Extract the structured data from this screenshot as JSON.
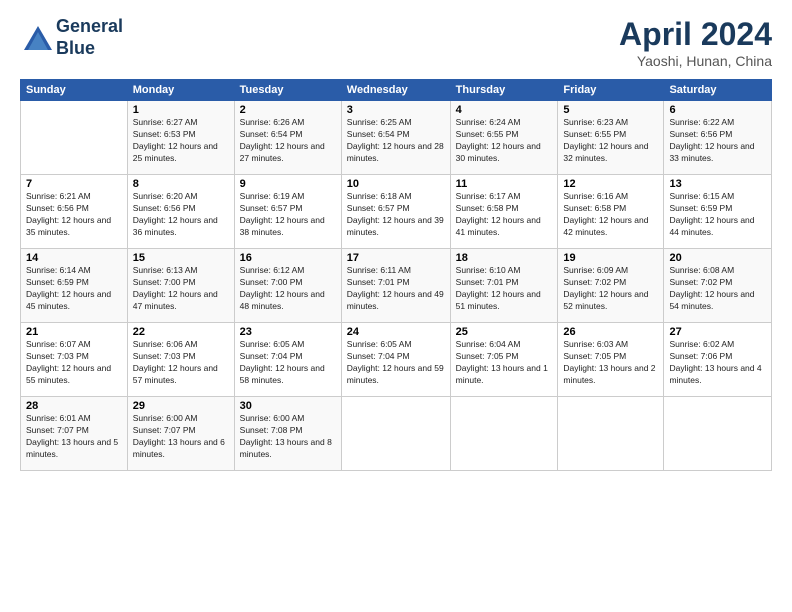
{
  "header": {
    "logo_line1": "General",
    "logo_line2": "Blue",
    "month": "April 2024",
    "location": "Yaoshi, Hunan, China"
  },
  "days_of_week": [
    "Sunday",
    "Monday",
    "Tuesday",
    "Wednesday",
    "Thursday",
    "Friday",
    "Saturday"
  ],
  "weeks": [
    [
      {
        "day": "",
        "sunrise": "",
        "sunset": "",
        "daylight": ""
      },
      {
        "day": "1",
        "sunrise": "Sunrise: 6:27 AM",
        "sunset": "Sunset: 6:53 PM",
        "daylight": "Daylight: 12 hours and 25 minutes."
      },
      {
        "day": "2",
        "sunrise": "Sunrise: 6:26 AM",
        "sunset": "Sunset: 6:54 PM",
        "daylight": "Daylight: 12 hours and 27 minutes."
      },
      {
        "day": "3",
        "sunrise": "Sunrise: 6:25 AM",
        "sunset": "Sunset: 6:54 PM",
        "daylight": "Daylight: 12 hours and 28 minutes."
      },
      {
        "day": "4",
        "sunrise": "Sunrise: 6:24 AM",
        "sunset": "Sunset: 6:55 PM",
        "daylight": "Daylight: 12 hours and 30 minutes."
      },
      {
        "day": "5",
        "sunrise": "Sunrise: 6:23 AM",
        "sunset": "Sunset: 6:55 PM",
        "daylight": "Daylight: 12 hours and 32 minutes."
      },
      {
        "day": "6",
        "sunrise": "Sunrise: 6:22 AM",
        "sunset": "Sunset: 6:56 PM",
        "daylight": "Daylight: 12 hours and 33 minutes."
      }
    ],
    [
      {
        "day": "7",
        "sunrise": "Sunrise: 6:21 AM",
        "sunset": "Sunset: 6:56 PM",
        "daylight": "Daylight: 12 hours and 35 minutes."
      },
      {
        "day": "8",
        "sunrise": "Sunrise: 6:20 AM",
        "sunset": "Sunset: 6:56 PM",
        "daylight": "Daylight: 12 hours and 36 minutes."
      },
      {
        "day": "9",
        "sunrise": "Sunrise: 6:19 AM",
        "sunset": "Sunset: 6:57 PM",
        "daylight": "Daylight: 12 hours and 38 minutes."
      },
      {
        "day": "10",
        "sunrise": "Sunrise: 6:18 AM",
        "sunset": "Sunset: 6:57 PM",
        "daylight": "Daylight: 12 hours and 39 minutes."
      },
      {
        "day": "11",
        "sunrise": "Sunrise: 6:17 AM",
        "sunset": "Sunset: 6:58 PM",
        "daylight": "Daylight: 12 hours and 41 minutes."
      },
      {
        "day": "12",
        "sunrise": "Sunrise: 6:16 AM",
        "sunset": "Sunset: 6:58 PM",
        "daylight": "Daylight: 12 hours and 42 minutes."
      },
      {
        "day": "13",
        "sunrise": "Sunrise: 6:15 AM",
        "sunset": "Sunset: 6:59 PM",
        "daylight": "Daylight: 12 hours and 44 minutes."
      }
    ],
    [
      {
        "day": "14",
        "sunrise": "Sunrise: 6:14 AM",
        "sunset": "Sunset: 6:59 PM",
        "daylight": "Daylight: 12 hours and 45 minutes."
      },
      {
        "day": "15",
        "sunrise": "Sunrise: 6:13 AM",
        "sunset": "Sunset: 7:00 PM",
        "daylight": "Daylight: 12 hours and 47 minutes."
      },
      {
        "day": "16",
        "sunrise": "Sunrise: 6:12 AM",
        "sunset": "Sunset: 7:00 PM",
        "daylight": "Daylight: 12 hours and 48 minutes."
      },
      {
        "day": "17",
        "sunrise": "Sunrise: 6:11 AM",
        "sunset": "Sunset: 7:01 PM",
        "daylight": "Daylight: 12 hours and 49 minutes."
      },
      {
        "day": "18",
        "sunrise": "Sunrise: 6:10 AM",
        "sunset": "Sunset: 7:01 PM",
        "daylight": "Daylight: 12 hours and 51 minutes."
      },
      {
        "day": "19",
        "sunrise": "Sunrise: 6:09 AM",
        "sunset": "Sunset: 7:02 PM",
        "daylight": "Daylight: 12 hours and 52 minutes."
      },
      {
        "day": "20",
        "sunrise": "Sunrise: 6:08 AM",
        "sunset": "Sunset: 7:02 PM",
        "daylight": "Daylight: 12 hours and 54 minutes."
      }
    ],
    [
      {
        "day": "21",
        "sunrise": "Sunrise: 6:07 AM",
        "sunset": "Sunset: 7:03 PM",
        "daylight": "Daylight: 12 hours and 55 minutes."
      },
      {
        "day": "22",
        "sunrise": "Sunrise: 6:06 AM",
        "sunset": "Sunset: 7:03 PM",
        "daylight": "Daylight: 12 hours and 57 minutes."
      },
      {
        "day": "23",
        "sunrise": "Sunrise: 6:05 AM",
        "sunset": "Sunset: 7:04 PM",
        "daylight": "Daylight: 12 hours and 58 minutes."
      },
      {
        "day": "24",
        "sunrise": "Sunrise: 6:05 AM",
        "sunset": "Sunset: 7:04 PM",
        "daylight": "Daylight: 12 hours and 59 minutes."
      },
      {
        "day": "25",
        "sunrise": "Sunrise: 6:04 AM",
        "sunset": "Sunset: 7:05 PM",
        "daylight": "Daylight: 13 hours and 1 minute."
      },
      {
        "day": "26",
        "sunrise": "Sunrise: 6:03 AM",
        "sunset": "Sunset: 7:05 PM",
        "daylight": "Daylight: 13 hours and 2 minutes."
      },
      {
        "day": "27",
        "sunrise": "Sunrise: 6:02 AM",
        "sunset": "Sunset: 7:06 PM",
        "daylight": "Daylight: 13 hours and 4 minutes."
      }
    ],
    [
      {
        "day": "28",
        "sunrise": "Sunrise: 6:01 AM",
        "sunset": "Sunset: 7:07 PM",
        "daylight": "Daylight: 13 hours and 5 minutes."
      },
      {
        "day": "29",
        "sunrise": "Sunrise: 6:00 AM",
        "sunset": "Sunset: 7:07 PM",
        "daylight": "Daylight: 13 hours and 6 minutes."
      },
      {
        "day": "30",
        "sunrise": "Sunrise: 6:00 AM",
        "sunset": "Sunset: 7:08 PM",
        "daylight": "Daylight: 13 hours and 8 minutes."
      },
      {
        "day": "",
        "sunrise": "",
        "sunset": "",
        "daylight": ""
      },
      {
        "day": "",
        "sunrise": "",
        "sunset": "",
        "daylight": ""
      },
      {
        "day": "",
        "sunrise": "",
        "sunset": "",
        "daylight": ""
      },
      {
        "day": "",
        "sunrise": "",
        "sunset": "",
        "daylight": ""
      }
    ]
  ]
}
